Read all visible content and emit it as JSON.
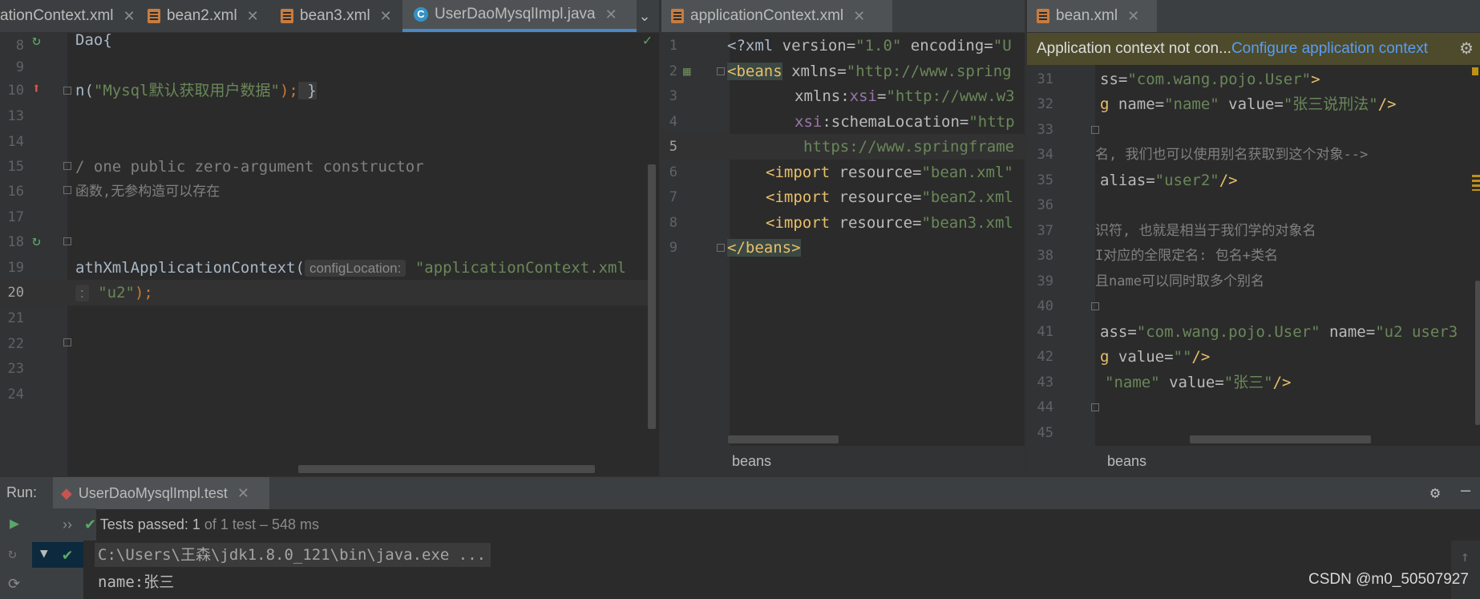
{
  "left_tabs": [
    {
      "label": "ationContext.xml",
      "type": "xml"
    },
    {
      "label": "bean2.xml",
      "type": "xml"
    },
    {
      "label": "bean3.xml",
      "type": "xml"
    },
    {
      "label": "UserDaoMysqlImpl.java",
      "type": "java",
      "active": true
    }
  ],
  "mid_tabs": [
    {
      "label": "applicationContext.xml",
      "type": "xml"
    }
  ],
  "right_tabs": [
    {
      "label": "bean.xml",
      "type": "xml"
    }
  ],
  "left_editor": {
    "line_numbers": [
      "8",
      "9",
      "10",
      "13",
      "14",
      "15",
      "16",
      "17",
      "18",
      "19",
      "20",
      "21",
      "22",
      "23",
      "24"
    ],
    "current_line": "20",
    "lines": {
      "l8": "Dao{",
      "l10_a": "n(",
      "l10_str": "\"Mysql默认获取用户数据\"",
      "l10_b": ");",
      "l10_brace": " }",
      "l15": "/ one public zero-argument constructor",
      "l16": "函数,无参构造可以存在",
      "l19_a": "athXmlApplicationContext(",
      "l19_hint": "configLocation:",
      "l19_str": "\"applicationContext.xml",
      "l20_a": ":",
      "l20_str": "\"u2\"",
      "l20_b": ");"
    }
  },
  "mid_editor": {
    "line_numbers": [
      "1",
      "2",
      "3",
      "4",
      "5",
      "6",
      "7",
      "8",
      "9"
    ],
    "current_line": "5",
    "lines": {
      "l1_a": "<?xml ",
      "l1_b": "version=",
      "l1_c": "\"1.0\"",
      "l1_d": " encoding=",
      "l1_e": "\"U",
      "l2_tag": "<beans",
      "l2_attr": " xmlns=",
      "l2_str": "\"http://www.spring",
      "l3_attr": "xmlns:",
      "l3_ns": "xsi",
      "l3_eq": "=",
      "l3_str": "\"http://www.w3",
      "l4_ns": "xsi",
      "l4_attr": ":schemaLocation=",
      "l4_str": "\"http",
      "l5_str": "https://www.springframe",
      "l6_tag": "<import",
      "l6_attr": " resource=",
      "l6_str": "\"bean.xml\"",
      "l7_tag": "<import",
      "l7_attr": " resource=",
      "l7_str": "\"bean2.xml",
      "l8_tag": "<import",
      "l8_attr": " resource=",
      "l8_str": "\"bean3.xml",
      "l9_tag": "</beans>"
    },
    "breadcrumb": "beans"
  },
  "right_editor": {
    "banner_text": "Application context not con...",
    "banner_link": "Configure application context",
    "line_numbers": [
      "31",
      "32",
      "33",
      "34",
      "35",
      "36",
      "37",
      "38",
      "39",
      "40",
      "41",
      "42",
      "43",
      "44",
      "45"
    ],
    "lines": {
      "l31_a": "ss=",
      "l31_str": "\"com.wang.pojo.User\"",
      "l31_b": ">",
      "l32_a": "g",
      "l32_b": " name=",
      "l32_c": "\"name\"",
      "l32_d": " value=",
      "l32_e": "\"张三说刑法\"",
      "l32_f": "/>",
      "l34": "名, 我们也可以使用别名获取到这个对象-->",
      "l35_a": "alias=",
      "l35_str": "\"user2\"",
      "l35_b": "/>",
      "l37": "识符, 也就是相当于我们学的对象名",
      "l38": "I对应的全限定名: 包名+类名",
      "l39": "且name可以同时取多个别名",
      "l41_a": "ass=",
      "l41_str": "\"com.wang.pojo.User\"",
      "l41_b": " name=",
      "l41_c": "\"u2 user3",
      "l42_a": "g",
      "l42_b": " value=",
      "l42_c": "\"\"",
      "l42_d": "/>",
      "l43_a": "\"name\"",
      "l43_b": " value=",
      "l43_c": "\"张三\"",
      "l43_d": "/>"
    },
    "breadcrumb": "beans"
  },
  "run_panel": {
    "label": "Run:",
    "config": "UserDaoMysqlImpl.test",
    "tests_passed": "Tests passed:",
    "tests_count": "1",
    "tests_detail": "of 1 test – 548 ms",
    "console_line1": "C:\\Users\\王森\\jdk1.8.0_121\\bin\\java.exe ...",
    "console_line2": "name:张三"
  },
  "watermark": "CSDN @m0_50507927"
}
